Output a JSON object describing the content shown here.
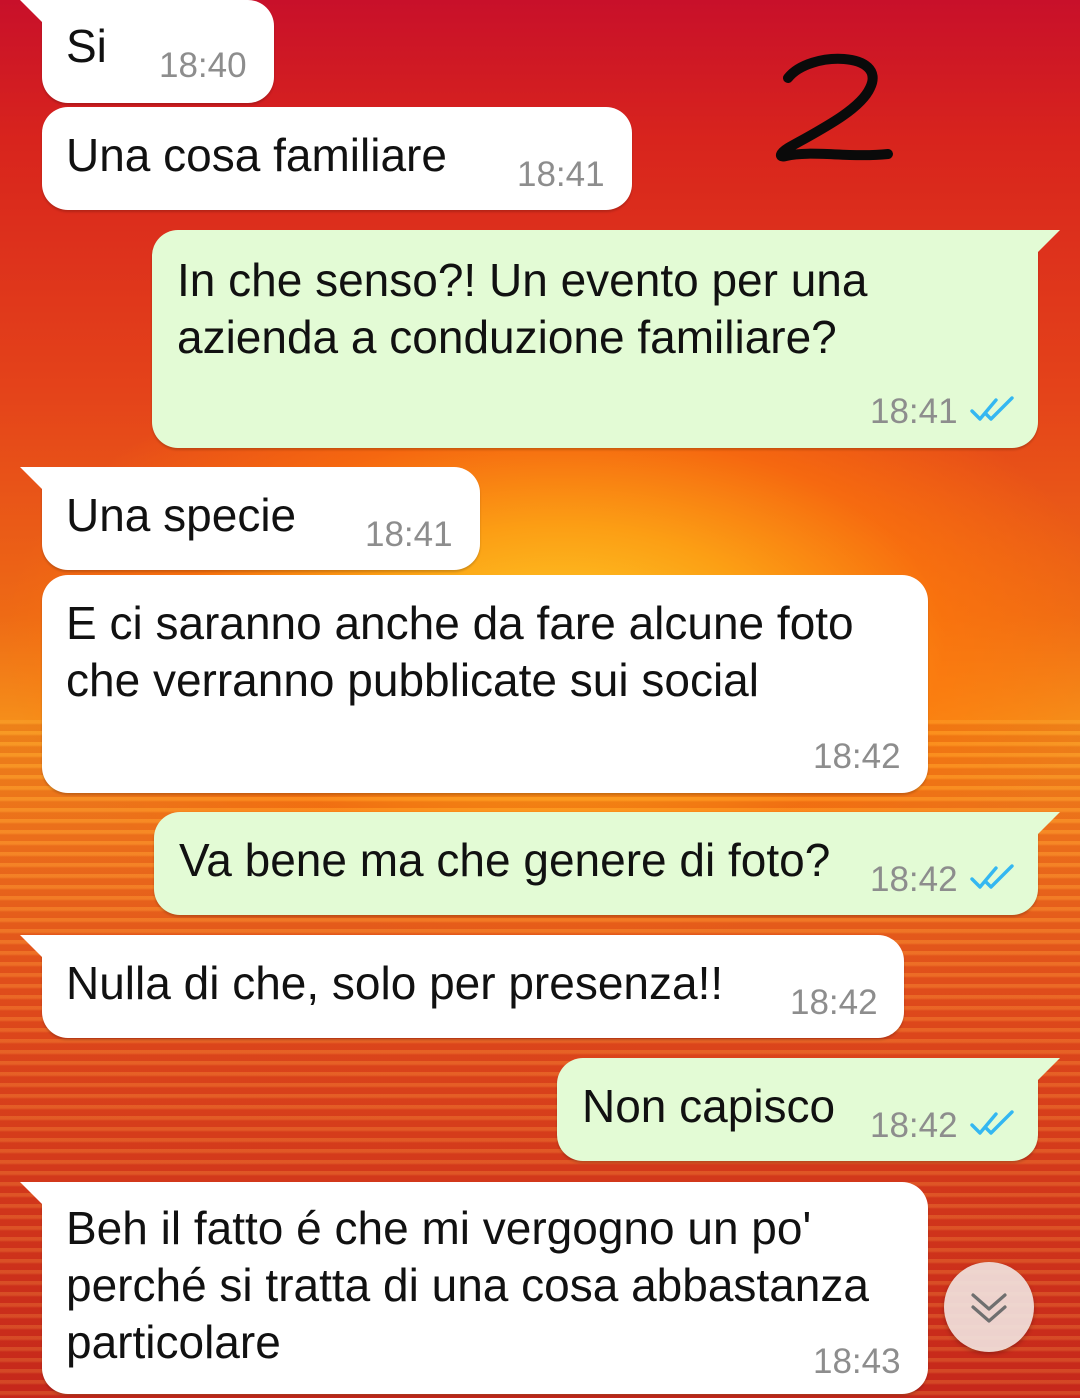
{
  "annotation": "2",
  "messages": [
    {
      "direction": "in",
      "text": "Si",
      "time": "18:40"
    },
    {
      "direction": "in",
      "text": "Una cosa familiare",
      "time": "18:41"
    },
    {
      "direction": "out",
      "text": "In che senso?! Un evento per una\nazienda a conduzione familiare?",
      "time": "18:41",
      "read": true
    },
    {
      "direction": "in",
      "text": "Una specie",
      "time": "18:41"
    },
    {
      "direction": "in",
      "text": "E ci saranno anche da fare alcune foto\nche verranno pubblicate sui social",
      "time": "18:42"
    },
    {
      "direction": "out",
      "text": "Va bene ma che genere di foto?",
      "time": "18:42",
      "read": true
    },
    {
      "direction": "in",
      "text": "Nulla di che, solo per presenza!!",
      "time": "18:42"
    },
    {
      "direction": "out",
      "text": "Non capisco",
      "time": "18:42",
      "read": true
    },
    {
      "direction": "in",
      "text": "Beh il fatto é che mi vergogno un po'\nperché si tratta di una cosa abbastanza\nparticolare",
      "time": "18:43"
    }
  ],
  "colors": {
    "incoming_bubble": "#ffffff",
    "outgoing_bubble": "#e3fbd5",
    "read_ticks": "#34b7f1",
    "timestamp": "#8d8d8d"
  },
  "icons": {
    "read_receipt": "double-check-icon",
    "scroll_down": "chevron-double-down-icon"
  }
}
